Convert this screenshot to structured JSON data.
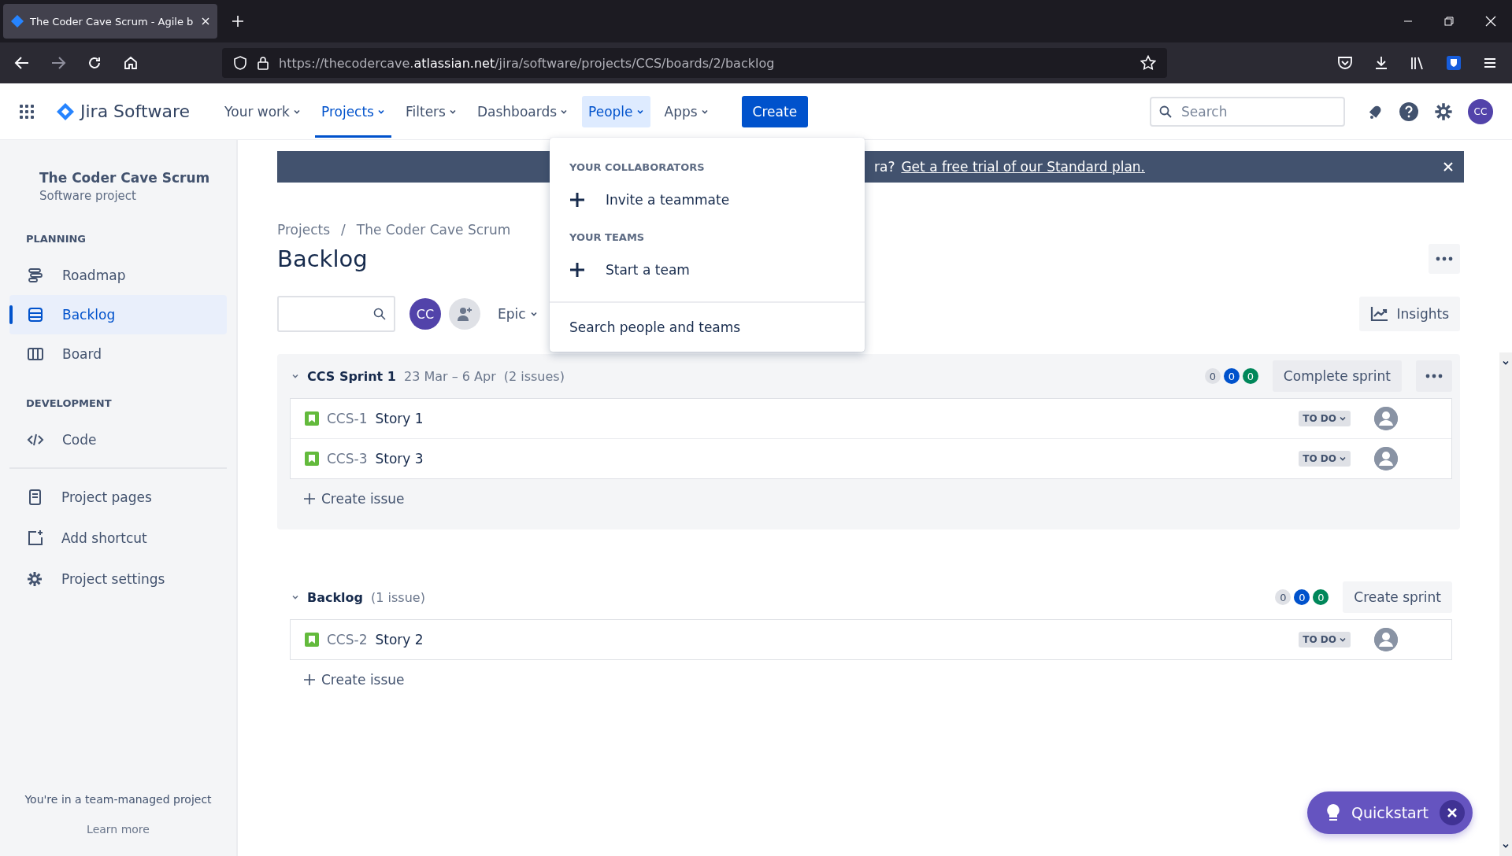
{
  "browser": {
    "tab_title": "The Coder Cave Scrum - Agile b",
    "url_prefix": "https://thecodercave.",
    "url_domain": "atlassian.net",
    "url_path": "/jira/software/projects/CCS/boards/2/backlog"
  },
  "header": {
    "product": "Jira Software",
    "nav": [
      {
        "label": "Your work",
        "selected": false,
        "open": false
      },
      {
        "label": "Projects",
        "selected": true,
        "open": false
      },
      {
        "label": "Filters",
        "selected": false,
        "open": false
      },
      {
        "label": "Dashboards",
        "selected": false,
        "open": false
      },
      {
        "label": "People",
        "selected": false,
        "open": true
      },
      {
        "label": "Apps",
        "selected": false,
        "open": false
      }
    ],
    "create": "Create",
    "search_placeholder": "Search",
    "avatar": "CC"
  },
  "sidebar": {
    "project": "The Coder Cave Scrum",
    "project_type": "Software project",
    "sections": [
      {
        "title": "PLANNING",
        "items": [
          {
            "label": "Roadmap",
            "selected": false
          },
          {
            "label": "Backlog",
            "selected": true
          },
          {
            "label": "Board",
            "selected": false
          }
        ]
      },
      {
        "title": "DEVELOPMENT",
        "items": [
          {
            "label": "Code",
            "selected": false
          }
        ]
      }
    ],
    "links": [
      "Project pages",
      "Add shortcut",
      "Project settings"
    ],
    "footer": "You're in a team-managed project",
    "learn_more": "Learn more"
  },
  "people_menu": {
    "sections": [
      {
        "title": "YOUR COLLABORATORS",
        "items": [
          "Invite a teammate"
        ]
      },
      {
        "title": "YOUR TEAMS",
        "items": [
          "Start a team"
        ]
      }
    ],
    "footer": "Search people and teams"
  },
  "banner": {
    "text": "ra?",
    "link": "Get a free trial of our Standard plan."
  },
  "breadcrumbs": [
    "Projects",
    "/",
    "The Coder Cave Scrum"
  ],
  "title": "Backlog",
  "toolbar": {
    "avatar": "CC",
    "epic": "Epic",
    "insights": "Insights"
  },
  "sprints": [
    {
      "name": "CCS Sprint 1",
      "dates": "23 Mar – 6 Apr",
      "count": "(2 issues)",
      "kind": "sprint",
      "counts": [
        {
          "value": "0",
          "color": "#dfe1e6"
        },
        {
          "value": "0",
          "color": "#0052cc"
        },
        {
          "value": "0",
          "color": "#00875a"
        }
      ],
      "action": "Complete sprint",
      "more": true,
      "issues": [
        {
          "key": "CCS-1",
          "summary": "Story 1",
          "status": "TO DO"
        },
        {
          "key": "CCS-3",
          "summary": "Story 3",
          "status": "TO DO"
        }
      ],
      "create": "Create issue"
    },
    {
      "name": "Backlog",
      "count": "(1 issue)",
      "kind": "backlog",
      "counts": [
        {
          "value": "0",
          "color": "#dfe1e6"
        },
        {
          "value": "0",
          "color": "#0052cc"
        },
        {
          "value": "0",
          "color": "#00875a"
        }
      ],
      "action": "Create sprint",
      "more": false,
      "issues": [
        {
          "key": "CCS-2",
          "summary": "Story 2",
          "status": "TO DO"
        }
      ],
      "create": "Create issue"
    }
  ],
  "quickstart": "Quickstart"
}
